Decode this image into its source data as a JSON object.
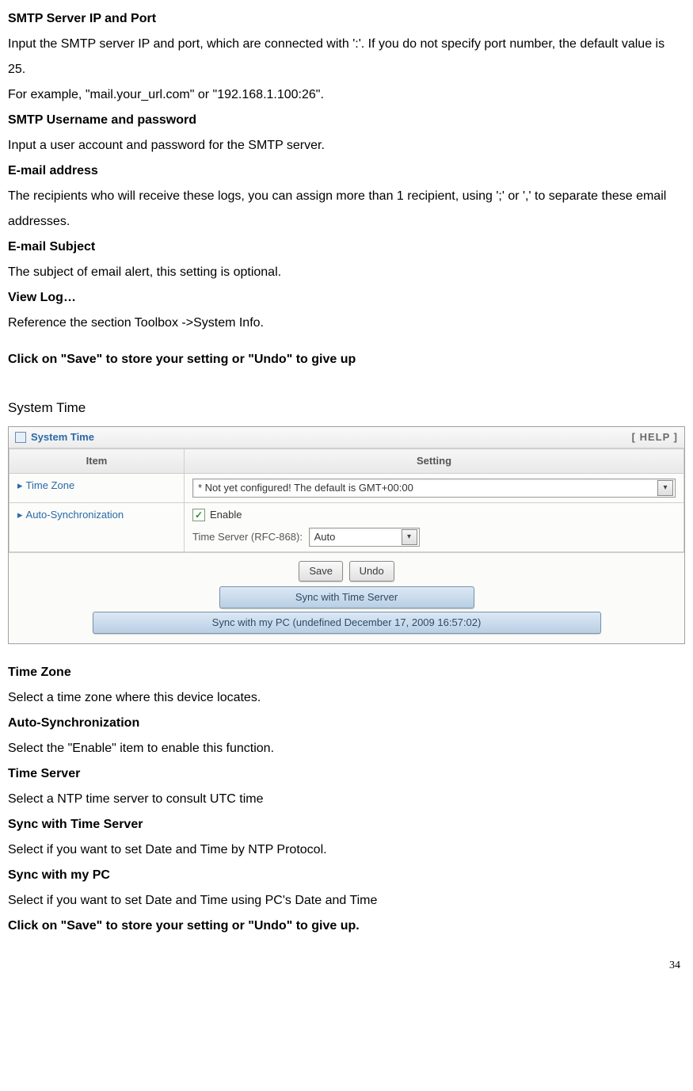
{
  "doc": {
    "smtp_server_heading": "SMTP Server IP and Port",
    "smtp_server_p1": "Input the SMTP server IP and port, which are connected with ':'. If you do not specify port number, the default value is 25.",
    "smtp_server_p2": "For example, \"mail.your_url.com\" or \"192.168.1.100:26\".",
    "smtp_user_heading": "SMTP Username and password",
    "smtp_user_p": "Input a user account and password for the SMTP server.",
    "email_addr_heading": "E-mail address",
    "email_addr_p": "The recipients who will receive these logs, you can assign more than 1 recipient, using ';' or ',' to separate these email addresses.",
    "email_subj_heading": "E-mail Subject",
    "email_subj_p": "The subject of email alert, this setting is optional.",
    "viewlog_heading": "View Log…",
    "viewlog_p": "Reference the section Toolbox ->System Info.",
    "save_undo_1": "Click on \"Save\" to store your setting or \"Undo\" to give up",
    "system_time_heading": "System Time",
    "tz_heading": "Time Zone",
    "tz_p": "Select a time zone where this device locates.",
    "autosync_heading": "Auto-Synchronization",
    "autosync_p": "Select the \"Enable\" item to enable this function.",
    "timeserver_heading": "Time Server",
    "timeserver_p": "Select a NTP time server to consult UTC time",
    "syncts_heading": "Sync with Time Server",
    "syncts_p": "Select if you want to set Date and Time by NTP Protocol.",
    "syncpc_heading": "Sync with my PC",
    "syncpc_p": "Select if you want to set Date and Time using PC's Date and Time",
    "save_undo_2": "Click on \"Save\" to store your setting or \"Undo\" to give up.",
    "page_number": "34"
  },
  "panel": {
    "title": "System Time",
    "help_label": "[ HELP ]",
    "col_item": "Item",
    "col_setting": "Setting",
    "row_tz_label": "Time Zone",
    "row_tz_value": "* Not yet configured! The default is GMT+00:00",
    "row_autosync_label": "Auto-Synchronization",
    "enable_label": "Enable",
    "enable_checked": true,
    "timeserver_prefix": "Time Server (RFC-868):",
    "timeserver_value": "Auto",
    "btn_save": "Save",
    "btn_undo": "Undo",
    "btn_sync_server": "Sync with Time Server",
    "btn_sync_pc": "Sync with my PC (undefined December 17, 2009 16:57:02)"
  }
}
